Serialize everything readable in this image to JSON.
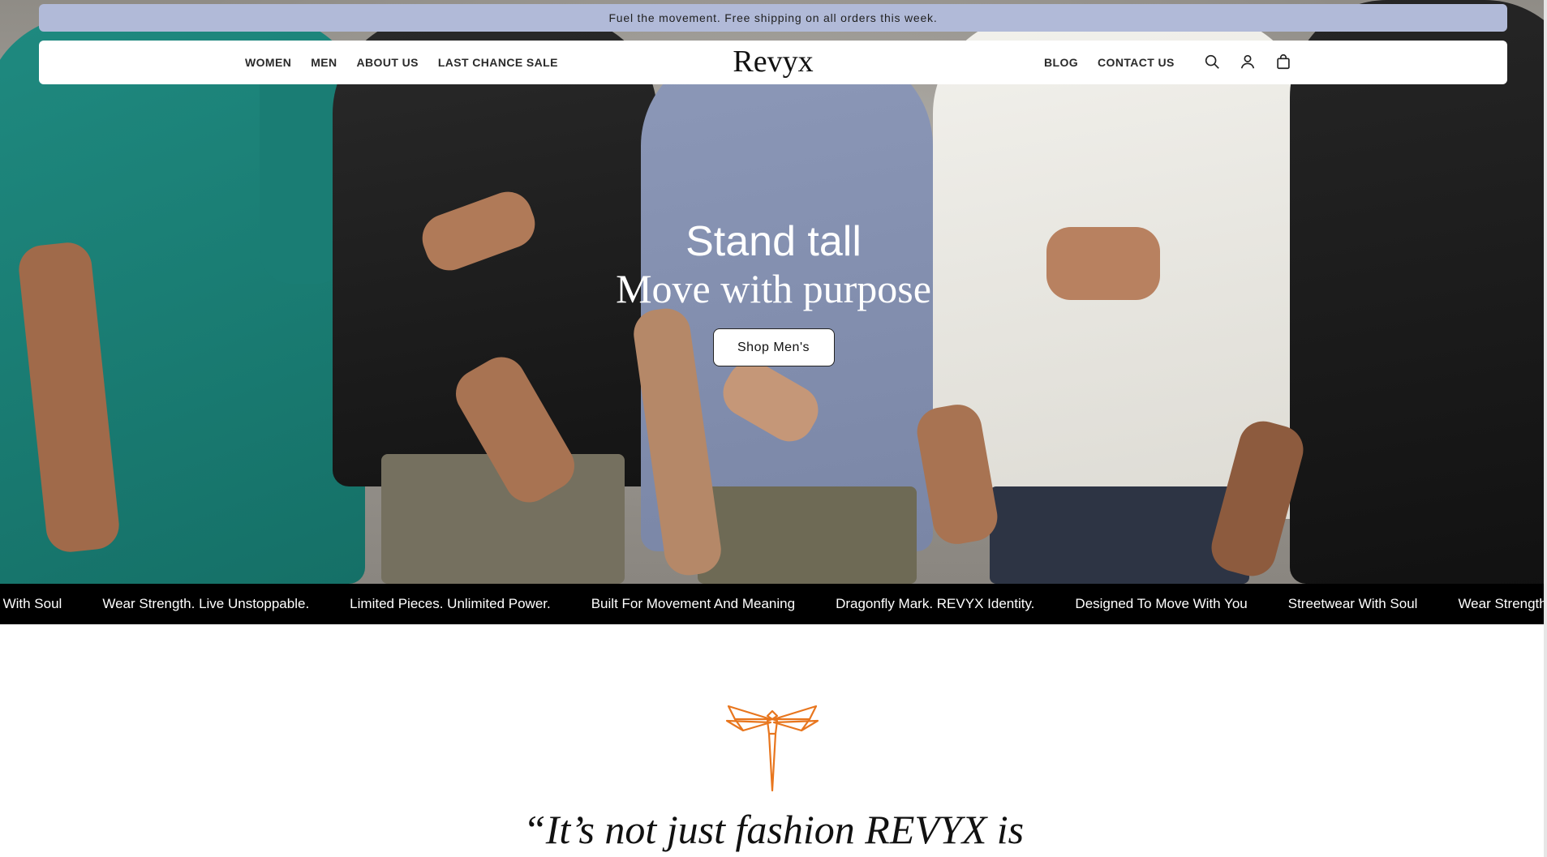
{
  "announcement": {
    "text": "Fuel the movement. Free shipping on all orders this week."
  },
  "header": {
    "logo": "Revyx",
    "nav_left": [
      "WOMEN",
      "MEN",
      "ABOUT US",
      "LAST CHANCE SALE"
    ],
    "nav_right": [
      "BLOG",
      "CONTACT US"
    ],
    "icons": [
      "search-icon",
      "account-icon",
      "cart-icon"
    ]
  },
  "hero": {
    "title": "Stand tall",
    "subtitle": "Move with purpose",
    "button_label": "Shop Men's"
  },
  "marquee": {
    "items": [
      "wear With Soul",
      "Wear Strength. Live Unstoppable.",
      "Limited Pieces. Unlimited Power.",
      "Built For Movement And Meaning",
      "Dragonfly Mark. REVYX Identity.",
      "Designed To Move With You",
      "Streetwear With Soul",
      "Wear Strength. Live Un"
    ]
  },
  "brand": {
    "icon": "dragonfly-icon",
    "accent_color": "#e8761e",
    "quote": "“It’s not just fashion REVYX is"
  }
}
